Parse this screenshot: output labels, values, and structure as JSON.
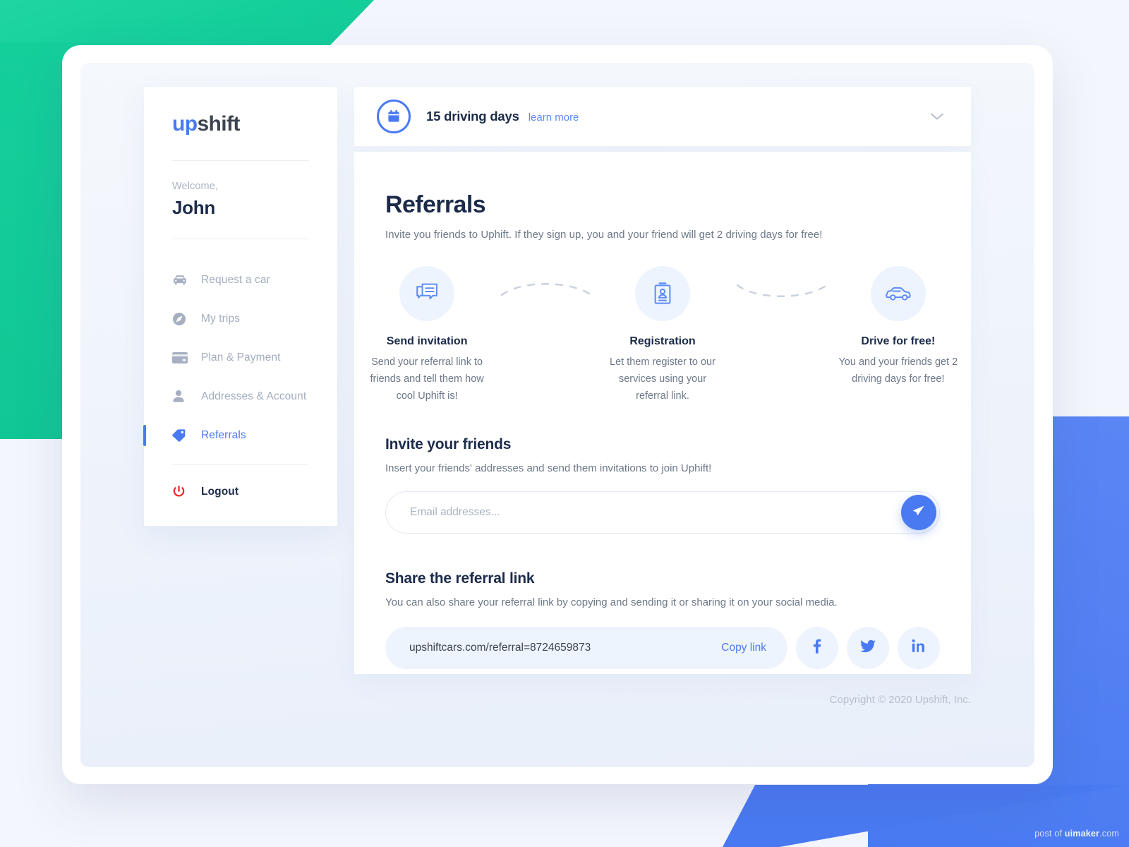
{
  "brand": {
    "logo_up": "up",
    "logo_shift": "shift"
  },
  "sidebar": {
    "welcome_label": "Welcome,",
    "user_name": "John",
    "items": [
      {
        "label": "Request a car",
        "icon": "car-icon",
        "active": false
      },
      {
        "label": "My trips",
        "icon": "compass-icon",
        "active": false
      },
      {
        "label": "Plan & Payment",
        "icon": "credit-card-icon",
        "active": false
      },
      {
        "label": "Addresses & Account",
        "icon": "person-icon",
        "active": false
      },
      {
        "label": "Referrals",
        "icon": "tag-icon",
        "active": true
      }
    ],
    "logout": {
      "label": "Logout",
      "icon": "power-icon"
    }
  },
  "banner": {
    "icon": "calendar-icon",
    "title": "15 driving days",
    "link": "learn more",
    "chevron": "chevron-down-icon"
  },
  "main": {
    "title": "Referrals",
    "subtitle": "Invite you friends to Uphift. If they sign up, you and your friend will get 2 driving days for free!",
    "steps": [
      {
        "icon": "chat-bubbles-icon",
        "title": "Send invitation",
        "desc": "Send your referral link to friends and tell them how cool Uphift is!"
      },
      {
        "icon": "id-card-icon",
        "title": "Registration",
        "desc": "Let them register to our services using your referral link."
      },
      {
        "icon": "car-side-icon",
        "title": "Drive for free!",
        "desc": "You and your friends get 2 driving days for free!"
      }
    ],
    "invite": {
      "title": "Invite your friends",
      "subtitle": "Insert your friends' addresses and send them invitations to join Uphift!",
      "input_value": "",
      "input_placeholder": "Email addresses...",
      "send_icon": "send-paper-plane-icon"
    },
    "share": {
      "title": "Share the referral link",
      "subtitle": "You can also share your referral link by copying and sending it or sharing it on your social media.",
      "url": "upshiftcars.com/referral=8724659873",
      "copy_label": "Copy link",
      "socials": [
        {
          "name": "facebook-icon",
          "glyph": "f"
        },
        {
          "name": "twitter-icon",
          "glyph": "t"
        },
        {
          "name": "linkedin-icon",
          "glyph": "in"
        }
      ]
    }
  },
  "footer": {
    "copyright": "Copyright © 2020 Upshift, Inc."
  },
  "watermark": {
    "prefix": "post of ",
    "brand": "uimaker",
    "suffix": ".com"
  },
  "colors": {
    "accent_blue": "#4a7af2",
    "accent_green": "#15cf9b",
    "navy": "#1c2b4a",
    "muted": "#6d7888",
    "logout_red": "#ef2b2b"
  }
}
